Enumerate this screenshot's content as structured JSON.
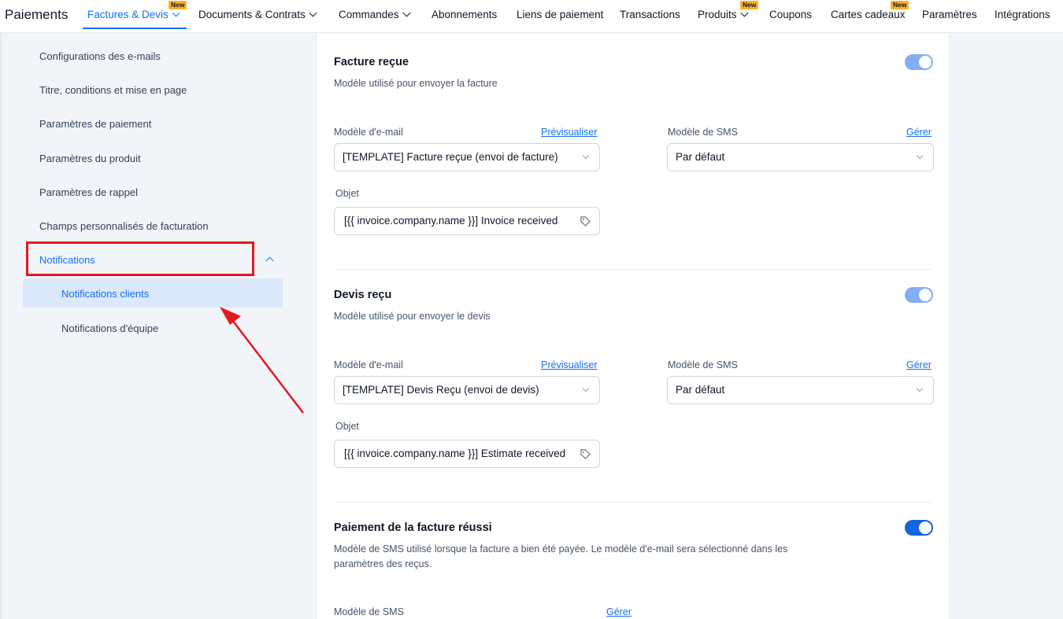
{
  "nav": {
    "brand": "Paiements",
    "badge": "New",
    "items": [
      {
        "label": "Factures & Devis"
      },
      {
        "label": "Documents & Contrats"
      },
      {
        "label": "Commandes"
      },
      {
        "label": "Abonnements"
      },
      {
        "label": "Liens de paiement"
      },
      {
        "label": "Transactions"
      },
      {
        "label": "Produits"
      },
      {
        "label": "Coupons"
      },
      {
        "label": "Cartes cadeaux"
      },
      {
        "label": "Paramètres"
      },
      {
        "label": "Intégrations"
      }
    ]
  },
  "sidebar": {
    "items": [
      {
        "label": "Configurations des e-mails"
      },
      {
        "label": "Titre, conditions et mise en page"
      },
      {
        "label": "Paramètres de paiement"
      },
      {
        "label": "Paramètres du produit"
      },
      {
        "label": "Paramètres de rappel"
      },
      {
        "label": "Champs personnalisés de facturation"
      },
      {
        "label": "Notifications"
      }
    ],
    "subitems": [
      {
        "label": "Notifications clients"
      },
      {
        "label": "Notifications d'équipe"
      }
    ]
  },
  "labels": {
    "email_model": "Modèle d'e-mail",
    "preview": "Prévisualiser",
    "sms_model": "Modèle de SMS",
    "manage": "Gérer",
    "subject": "Objet"
  },
  "sections": [
    {
      "title": "Facture reçue",
      "desc": "Modèle utilisé pour envoyer la facture",
      "enabled": true,
      "email_template": "[TEMPLATE] Facture reçue (envoi de facture)",
      "sms_template": "Par défaut",
      "subject": "[{{ invoice.company.name }}] Invoice received"
    },
    {
      "title": "Devis reçu",
      "desc": "Modèle utilisé pour envoyer le devis",
      "enabled": true,
      "email_template": "[TEMPLATE] Devis Reçu (envoi de devis)",
      "sms_template": "Par défaut",
      "subject": "[{{ invoice.company.name }}] Estimate received"
    },
    {
      "title": "Paiement de la facture réussi",
      "desc_line1": "Modèle de SMS utilisé lorsque la facture a bien été payée. Le modèle d'e-mail sera sélectionné dans les",
      "desc_line2": "paramètres des reçus.",
      "enabled": true
    }
  ],
  "colors": {
    "accent": "#1570ef",
    "annotation": "#e8171d",
    "toggle_light": "#84adf5",
    "toggle_strong": "#1565e0"
  }
}
